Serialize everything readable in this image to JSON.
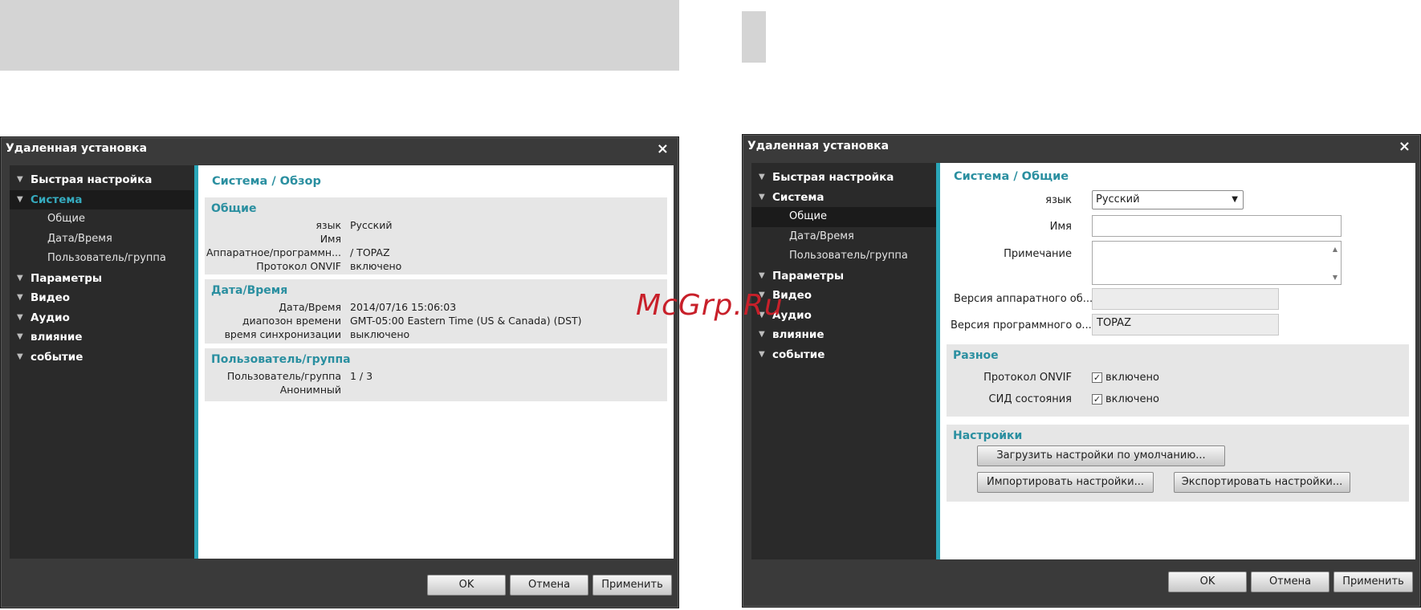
{
  "left": {
    "title": "Удаленная установка",
    "close": "×",
    "tree": {
      "quick": "Быстрая настройка",
      "system": "Система",
      "general": "Общие",
      "datetime": "Дата/Время",
      "usergroup": "Пользователь/группа",
      "params": "Параметры",
      "video": "Видео",
      "audio": "Аудио",
      "influence": "влияние",
      "event": "событие"
    },
    "page_title": "Система / Обзор",
    "general": {
      "title": "Общие",
      "rows": [
        {
          "k": "язык",
          "v": "Русский"
        },
        {
          "k": "Имя",
          "v": ""
        },
        {
          "k": "Аппаратное/программн...",
          "v": " / TOPAZ"
        },
        {
          "k": "Протокол ONVIF",
          "v": "включено"
        }
      ]
    },
    "datetime": {
      "title": "Дата/Время",
      "rows": [
        {
          "k": "Дата/Время",
          "v": "2014/07/16 15:06:03"
        },
        {
          "k": "диапозон времени",
          "v": "GMT-05:00 Eastern Time (US & Canada) (DST)"
        },
        {
          "k": "время синхронизации",
          "v": "выключено"
        }
      ]
    },
    "usergroup": {
      "title": "Пользователь/группа",
      "rows": [
        {
          "k": "Пользователь/группа",
          "v": "1 / 3"
        },
        {
          "k": "Анонимный",
          "v": ""
        }
      ]
    },
    "buttons": {
      "ok": "OK",
      "cancel": "Отмена",
      "apply": "Применить"
    }
  },
  "right": {
    "title": "Удаленная установка",
    "close": "×",
    "tree": {
      "quick": "Быстрая настройка",
      "system": "Система",
      "general": "Общие",
      "datetime": "Дата/Время",
      "usergroup": "Пользователь/группа",
      "params": "Параметры",
      "video": "Видео",
      "audio": "Аудио",
      "influence": "влияние",
      "event": "событие"
    },
    "page_title": "Система / Общие",
    "form": {
      "language_label": "язык",
      "language_value": "Русский",
      "name_label": "Имя",
      "name_value": "",
      "note_label": "Примечание",
      "hw_label": "Версия аппаратного об...",
      "hw_value": "",
      "sw_label": "Версия программного о...",
      "sw_value": "TOPAZ"
    },
    "misc": {
      "title": "Разное",
      "onvif_label": "Протокол ONVIF",
      "onvif_value": "включено",
      "onvif_checked": true,
      "led_label": "СИД состояния",
      "led_value": "включено",
      "led_checked": true
    },
    "settings": {
      "title": "Настройки",
      "load_default": "Загрузить настройки по умолчанию...",
      "import": "Импортировать настройки...",
      "export": "Экспортировать настройки..."
    },
    "buttons": {
      "ok": "OK",
      "cancel": "Отмена",
      "apply": "Применить"
    }
  },
  "watermark": "McGrp.Ru",
  "colors": {
    "accent": "#2aa6b8",
    "title_teal": "#2a8fa0",
    "dark_bg": "#3a3a3a",
    "tree_bg": "#2a2a2a",
    "watermark": "#c8202a"
  }
}
